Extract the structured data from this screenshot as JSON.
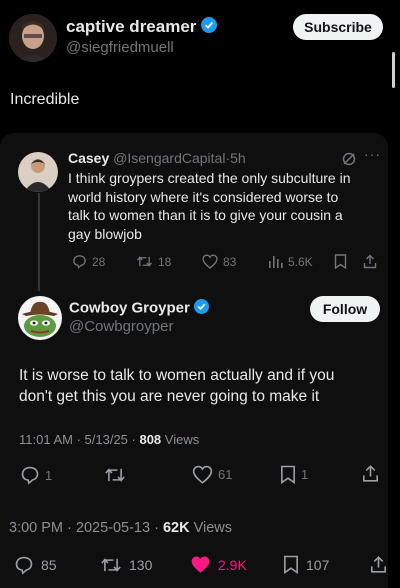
{
  "retweeter": {
    "name": "captive dreamer",
    "handle": "@siegfriedmuell",
    "subscribe_label": "Subscribe",
    "comment": "Incredible"
  },
  "quoted_tweet": {
    "name": "Casey",
    "handle": "@IsengardCapital",
    "time": "5h",
    "text_lines": [
      "I think groypers created the only subculture in",
      "world history where it's considered worse to",
      "talk to women than it is to give your cousin a",
      "gay blowjob"
    ],
    "replies": "28",
    "retweets": "18",
    "likes": "83",
    "views": "5.6K"
  },
  "reply_tweet": {
    "name": "Cowboy Groyper",
    "handle": "@Cowbgroyper",
    "follow_label": "Follow",
    "text_lines": [
      "It is worse to talk to women actually and if you",
      "don't get this you are never going to make it"
    ],
    "time": "11:01 AM",
    "date": "5/13/25",
    "views_count": "808",
    "views_label": "Views",
    "replies": "1",
    "likes": "61",
    "bookmarks": "1"
  },
  "main_meta": {
    "time": "3:00 PM",
    "date": "2025-05-13",
    "views_count": "62K",
    "views_label": "Views"
  },
  "main_actions": {
    "replies": "85",
    "retweets": "130",
    "likes": "2.9K",
    "bookmarks": "107"
  },
  "colors": {
    "background": "#000000",
    "verified": "#1d9bf0",
    "like_active": "#f91880",
    "muted": "#71767b"
  }
}
